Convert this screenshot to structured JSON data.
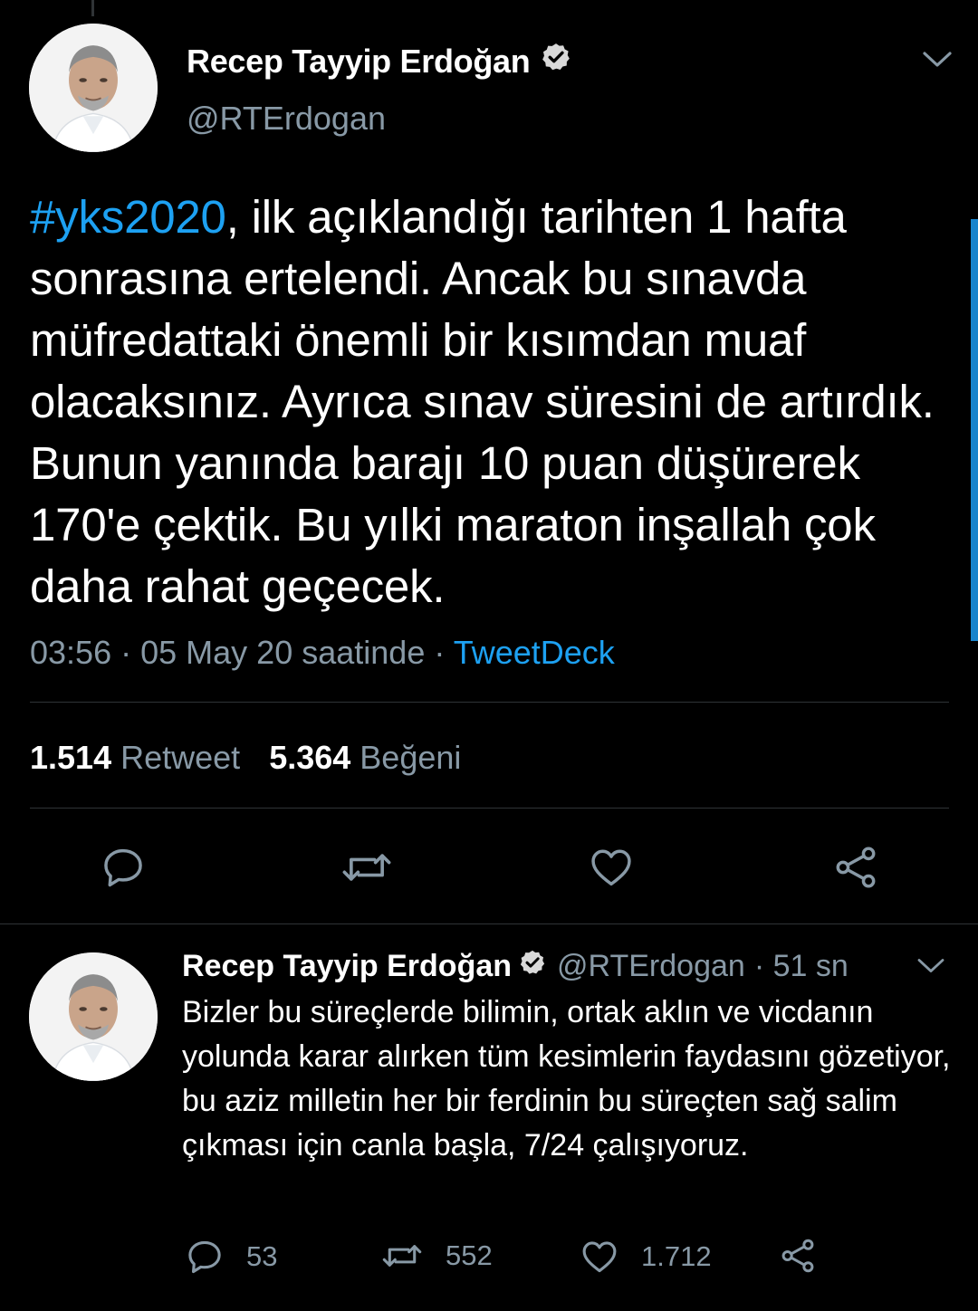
{
  "main_tweet": {
    "author_name": "Recep Tayyip Erdoğan",
    "handle": "@RTErdogan",
    "hashtag": "#yks2020",
    "text_after_hashtag": ", ilk açıklandığı tarihten 1 hafta sonrasına ertelendi. Ancak bu sınavda müfredattaki önemli bir kısımdan muaf olacaksınız. Ayrıca sınav süresini de artırdık. Bunun yanında barajı 10 puan düşürerek 170'e çektik. Bu yılki maraton inşallah çok daha rahat geçecek.",
    "time": "03:56",
    "separator": "·",
    "date": "05 May 20 saatinde",
    "source": "TweetDeck",
    "retweet_count": "1.514",
    "retweet_label": "Retweet",
    "like_count": "5.364",
    "like_label": "Beğeni"
  },
  "reply_tweet": {
    "author_name": "Recep Tayyip Erdoğan",
    "handle": "@RTErdogan",
    "time_ago": "· 51 sn",
    "text": "Bizler bu süreçlerde bilimin, ortak aklın ve vicdanın yolunda karar alırken tüm kesimlerin faydasını gözetiyor, bu aziz milletin her bir ferdinin bu süreçten sağ salim çıkması için canla başla, 7/24 çalışıyoruz.",
    "reply_count": "53",
    "retweet_count": "552",
    "like_count": "1.712"
  },
  "colors": {
    "background": "#000000",
    "accent": "#1da1f2",
    "secondary_text": "#8899a6",
    "divider": "#2f3336"
  },
  "icons": [
    "verified-badge-icon",
    "chevron-down-icon",
    "reply-icon",
    "retweet-icon",
    "like-icon",
    "share-icon"
  ]
}
